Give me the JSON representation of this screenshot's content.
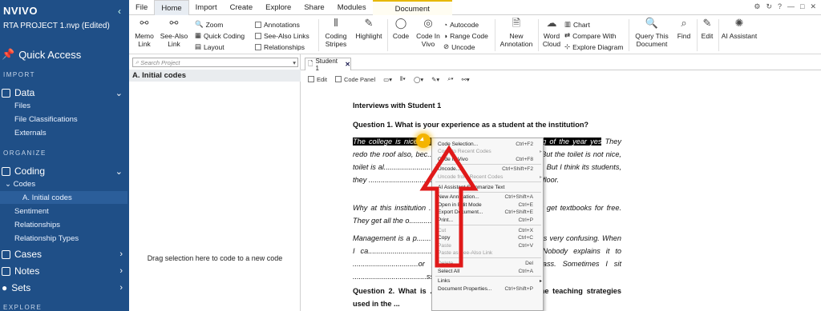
{
  "sidebar": {
    "logo": "NVIVO",
    "project": "RTA PROJECT 1.nvp (Edited)",
    "quick_access": "Quick Access",
    "sections": {
      "import": "IMPORT",
      "organize": "ORGANIZE",
      "explore": "EXPLORE"
    },
    "data": {
      "label": "Data",
      "items": [
        "Files",
        "File Classifications",
        "Externals"
      ]
    },
    "coding": {
      "label": "Coding",
      "codes": "Codes",
      "selected_code": "A. Initial codes",
      "items": [
        "Sentiment",
        "Relationships",
        "Relationship Types"
      ]
    },
    "cases": "Cases",
    "notes": "Notes",
    "sets": "Sets"
  },
  "ribbon": {
    "tabs": [
      "File",
      "Home",
      "Import",
      "Create",
      "Explore",
      "Share",
      "Modules",
      "Document"
    ],
    "active_tab": "Home",
    "buttons": {
      "memo_link": "Memo Link",
      "see_also_link": "See-Also Link",
      "zoom": "Zoom",
      "quick_coding": "Quick Coding",
      "layout": "Layout",
      "annotations": "Annotations",
      "see_also_links": "See-Also Links",
      "relationships": "Relationships",
      "coding_stripes": "Coding Stripes",
      "highlight": "Highlight",
      "code": "Code",
      "code_in_vivo": "Code In Vivo",
      "autocode": "Autocode",
      "range_code": "Range Code",
      "uncode": "Uncode",
      "new_annotation": "New Annotation",
      "word_cloud": "Word Cloud",
      "chart": "Chart",
      "compare_with": "Compare With",
      "explore_diagram": "Explore Diagram",
      "query_this_document": "Query This Document",
      "find": "Find",
      "edit": "Edit",
      "ai_assistant": "AI Assistant"
    }
  },
  "navpane": {
    "search_placeholder": "Search Project",
    "header": "A. Initial codes",
    "drag_hint": "Drag selection here to code to a new code"
  },
  "detail": {
    "tab_label": "Student 1",
    "toolbar": {
      "edit": "Edit",
      "code_panel": "Code Panel"
    },
    "document": {
      "title": "Interviews with Student 1",
      "q1": "Question 1. What is your experience as a student at the institution?",
      "a1_highlight": "The college is nice ",
      "a1_hidden": "............................................ beginning of the year yes",
      "a1_rest": " They redo the roof also, bec................................ssrooms leak. But the toilet is not nice, toilet is al............................................not clean all the time. But I think its students, they ........................................ there on the desk or on the floor.",
      "a2": "Why at this institution ........................................ions, they get textbooks for free. They get all the o......................................e, I must pay.",
      "a3": "Management is a p.................................e....the timetable is very confusing. When I ca.................................. I needed to be in class. Nobody explains it to ................................or group B. I just follow the class. Sometimes I sit ....................................ss.",
      "q2": "Question 2. What is ................................udent with the teaching strategies used in the ..."
    }
  },
  "context_menu": [
    {
      "label": "Code Selection...",
      "shortcut": "Ctrl+F2",
      "disabled": false
    },
    {
      "label": "Code to Recent Codes",
      "shortcut": "",
      "disabled": true,
      "submenu": true
    },
    {
      "label": "Code In Vivo",
      "shortcut": "Ctrl+F8",
      "disabled": false
    },
    {
      "sep": true
    },
    {
      "label": "Uncode...",
      "shortcut": "Ctrl+Shift+F2",
      "disabled": false
    },
    {
      "label": "Uncode from Recent Codes",
      "shortcut": "",
      "disabled": true,
      "submenu": true
    },
    {
      "sep": true
    },
    {
      "label": "AI Assistant Summarize Text",
      "shortcut": "",
      "disabled": false
    },
    {
      "sep": true
    },
    {
      "label": "New Annotation...",
      "shortcut": "Ctrl+Shift+A",
      "disabled": false
    },
    {
      "label": "Open in Edit Mode",
      "shortcut": "Ctrl+E",
      "disabled": false
    },
    {
      "label": "Export Document...",
      "shortcut": "Ctrl+Shift+E",
      "disabled": false
    },
    {
      "label": "Print...",
      "shortcut": "Ctrl+P",
      "disabled": false
    },
    {
      "sep": true
    },
    {
      "label": "Cut",
      "shortcut": "Ctrl+X",
      "disabled": true
    },
    {
      "label": "Copy",
      "shortcut": "Ctrl+C",
      "disabled": false
    },
    {
      "label": "Paste",
      "shortcut": "Ctrl+V",
      "disabled": true
    },
    {
      "label": "Paste as See-Also Link",
      "shortcut": "",
      "disabled": true
    },
    {
      "sep": true
    },
    {
      "label": "Delete",
      "shortcut": "Del",
      "disabled": true
    },
    {
      "label": "Select All",
      "shortcut": "Ctrl+A",
      "disabled": false
    },
    {
      "sep": true
    },
    {
      "label": "Links",
      "shortcut": "",
      "disabled": false,
      "submenu": true
    },
    {
      "label": "Document Properties...",
      "shortcut": "Ctrl+Shift+P",
      "disabled": false
    }
  ],
  "colors": {
    "sidebar": "#1f4f87",
    "annotation_arrow": "#e01919",
    "cursor_highlight": "#f4b400"
  }
}
